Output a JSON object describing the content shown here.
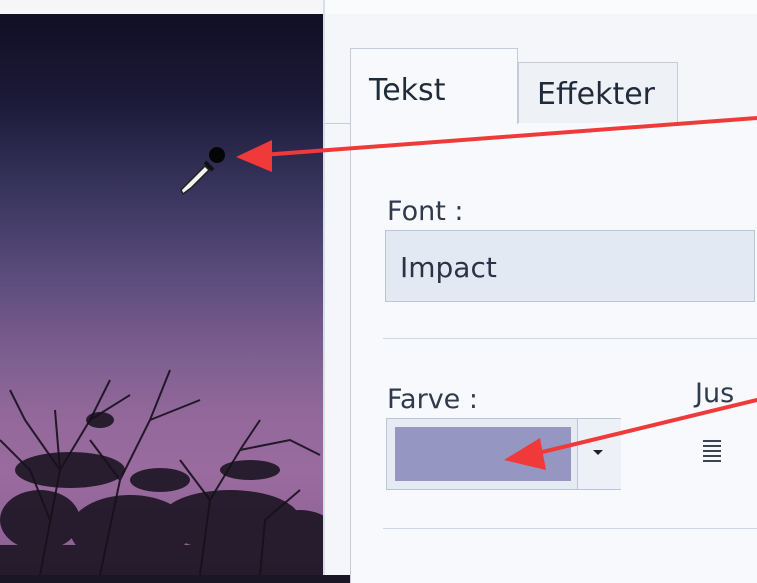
{
  "dialog": {
    "tabs": [
      {
        "label": "Tekst",
        "active": true
      },
      {
        "label": "Effekter",
        "active": false
      }
    ],
    "font": {
      "label": "Font :",
      "value": "Impact"
    },
    "color": {
      "label": "Farve :",
      "value": "#9597c2"
    },
    "justify_label": "Jus"
  },
  "colors": {
    "annotation_arrow": "#f03a3a",
    "panel_background": "#f4f6fa"
  },
  "icons": {
    "eyedropper": "eyedropper-icon",
    "dropdown": "chevron-down-icon",
    "align": "align-justify-icon"
  }
}
